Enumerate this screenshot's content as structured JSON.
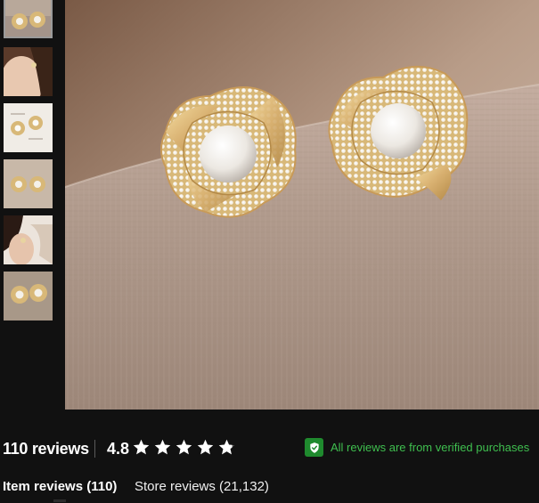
{
  "gallery": {
    "thumbnails": [
      {
        "name": "earrings-closeup",
        "selected": true
      },
      {
        "name": "model-wearing-earring",
        "selected": false
      },
      {
        "name": "size-chart",
        "selected": false,
        "label": "1.5cm"
      },
      {
        "name": "earrings-pair",
        "selected": false
      },
      {
        "name": "model-side-view",
        "selected": false
      },
      {
        "name": "earrings-detail",
        "selected": false
      }
    ],
    "main_image": {
      "subject": "gold-flower-pearl-stud-earrings"
    }
  },
  "reviews": {
    "count_label": "110 reviews",
    "rating": "4.8",
    "stars_filled": 4.8,
    "verified_label": "All reviews are from verified purchases"
  },
  "tabs": {
    "item_reviews": "Item reviews (110)",
    "store_reviews": "Store reviews (21,132)"
  },
  "colors": {
    "background": "#111111",
    "verified_green": "#3fbf4f",
    "badge_green": "#1f8a2e"
  }
}
